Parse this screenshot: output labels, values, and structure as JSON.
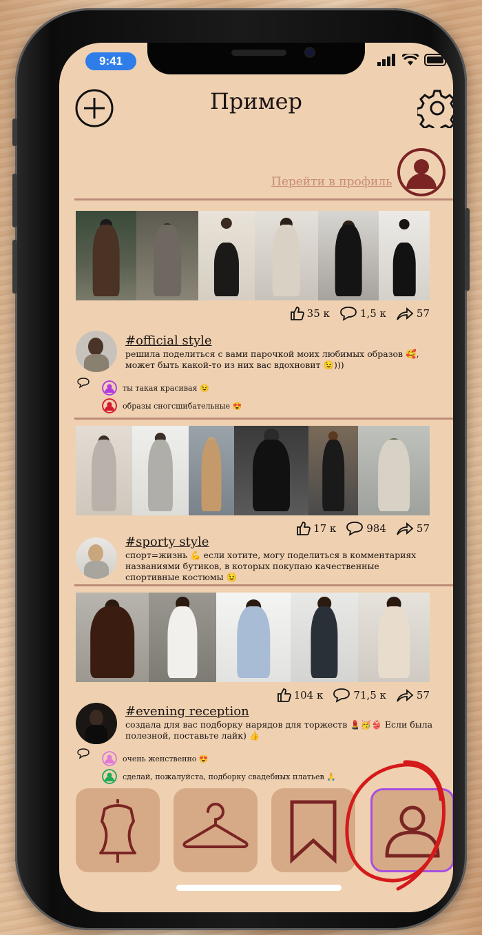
{
  "status_bar": {
    "time": "9:41"
  },
  "header": {
    "title": "Пример",
    "add_icon": "plus-circle-icon",
    "settings_icon": "gear-icon"
  },
  "profile": {
    "link_label": "Перейти в профиль",
    "avatar_icon": "user-avatar-icon"
  },
  "posts": [
    {
      "stats": {
        "likes": "35 к",
        "comments": "1,5 к",
        "shares": "57"
      },
      "title": "#official style",
      "text": "решила поделиться с вами парочкой моих любимых образов 🥰, может быть какой-то из них вас вдохновит 😉)))",
      "comments": [
        {
          "text": "ты такая красивая 😉",
          "color": "#b23be0"
        },
        {
          "text": "образы сногсшибательные 😍",
          "color": "#d41a2c"
        }
      ]
    },
    {
      "stats": {
        "likes": "17 к",
        "comments": "984",
        "shares": "57"
      },
      "title": "#sporty style",
      "text": "спорт=жизнь 💪 если хотите, могу поделиться в комментариях названиями бутиков, в которых покупаю качественные спортивные костюмы 😉",
      "comments": []
    },
    {
      "stats": {
        "likes": "104 к",
        "comments": "71,5 к",
        "shares": "57"
      },
      "title": "#evening reception",
      "text": "создала для вас подборку нарядов для торжеств 💄🥳👙 Если была полезной, поставьте лайк) 👍",
      "comments": [
        {
          "text": "очень женственно 😍",
          "color": "#e07ad9"
        },
        {
          "text": "сделай, пожалуйста, подборку свадебных платьев 🙏",
          "color": "#1faa5a"
        }
      ]
    }
  ],
  "tabbar": {
    "items": [
      {
        "icon": "dress-form-icon"
      },
      {
        "icon": "hanger-icon"
      },
      {
        "icon": "bookmark-icon"
      },
      {
        "icon": "profile-icon",
        "active": true
      }
    ]
  },
  "colors": {
    "screen_bg": "#efd1b1",
    "accent": "#7a2424",
    "divider": "#bd8b79",
    "tab_bg": "#d6aa86",
    "link": "#c88b73"
  }
}
